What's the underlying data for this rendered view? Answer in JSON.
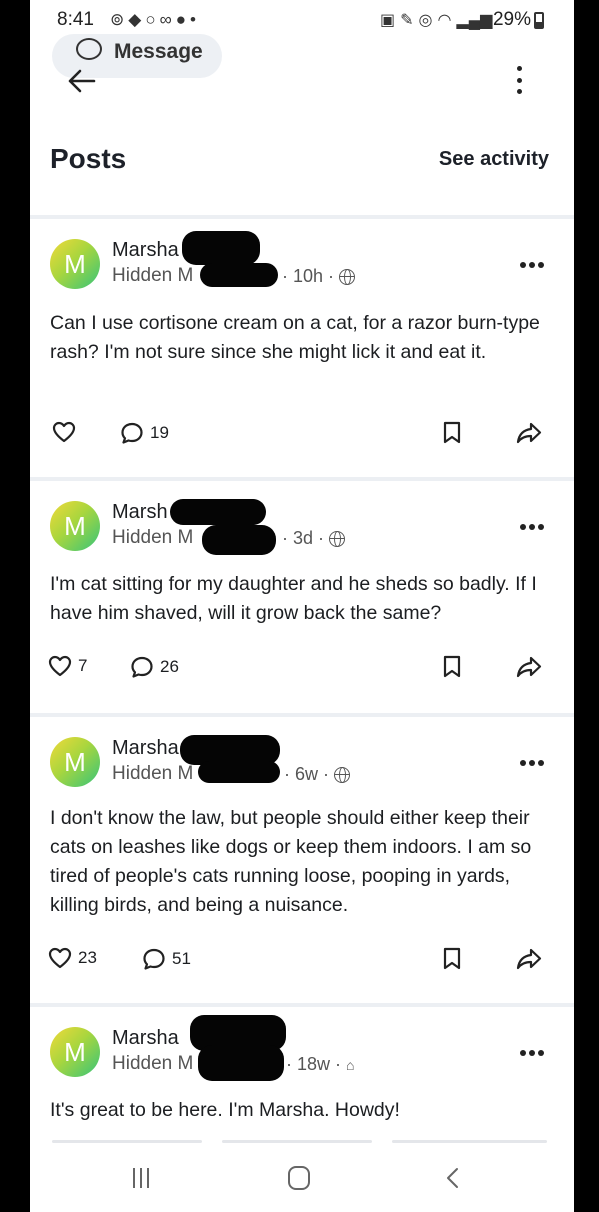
{
  "status_bar": {
    "time": "8:41",
    "battery": "29%",
    "left_icons": [
      "notification-icon",
      "messenger-icon",
      "circle-icon",
      "voicemail-icon",
      "account-icon",
      "dot-icon"
    ],
    "right_icons": [
      "lock-icon",
      "pen-icon",
      "alarm-icon",
      "wifi-icon",
      "signal-icon"
    ]
  },
  "message_button": {
    "label": "Message",
    "icon": "chat-bubble-icon"
  },
  "header": {
    "title": "Posts",
    "see_activity": "See activity"
  },
  "posts": [
    {
      "avatar_letter": "M",
      "author": "Marsha",
      "subtitle": "Hidden M",
      "time": "· 10h ·",
      "audience_icon": "globe-icon",
      "text": "Can I use cortisone cream on a cat, for a razor burn-type rash? I'm not sure since she might lick it and eat it.",
      "likes": "",
      "comments": "19"
    },
    {
      "avatar_letter": "M",
      "author": "Marsh",
      "subtitle": "Hidden M",
      "time": "· 3d ·",
      "audience_icon": "globe-icon",
      "text": "I'm cat sitting for my daughter and he sheds so badly. If I have him shaved, will it grow back the same?",
      "likes": "7",
      "comments": "26"
    },
    {
      "avatar_letter": "M",
      "author": "Marsha",
      "subtitle": "Hidden M",
      "time": "· 6w ·",
      "audience_icon": "globe-icon",
      "text": "I don't know the law, but people should either keep their cats on leashes like dogs or keep them indoors. I am so tired of people's cats running loose, pooping in yards, killing birds, and being a nuisance.",
      "likes": "23",
      "comments": "51"
    },
    {
      "avatar_letter": "M",
      "author": "Marsha",
      "subtitle": "Hidden M",
      "time": "· 18w ·",
      "audience_icon": "members-icon",
      "text": "It's great to be here. I'm Marsha. Howdy!",
      "likes": "",
      "comments": ""
    }
  ],
  "nav_bar": {
    "icons": [
      "recent-apps-icon",
      "home-icon",
      "back-icon"
    ]
  }
}
